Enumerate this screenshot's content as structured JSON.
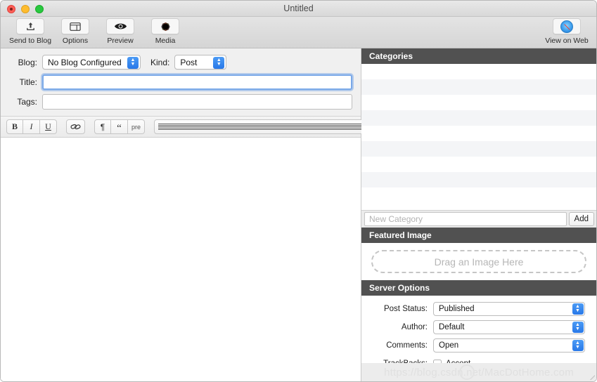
{
  "window": {
    "title": "Untitled",
    "traffic_lights": [
      "close-red",
      "minimize-yellow",
      "zoom-green"
    ]
  },
  "toolbar": {
    "items": [
      {
        "label": "Send to Blog",
        "icon": "upload-arrow-icon"
      },
      {
        "label": "Options",
        "icon": "window-layout-icon"
      },
      {
        "label": "Preview",
        "icon": "eye-icon"
      },
      {
        "label": "Media",
        "icon": "photos-pinwheel-icon"
      }
    ],
    "right_items": [
      {
        "label": "View on Web",
        "icon": "safari-compass-icon"
      }
    ]
  },
  "meta": {
    "blog_label": "Blog:",
    "blog_value": "No Blog Configured",
    "kind_label": "Kind:",
    "kind_value": "Post",
    "title_label": "Title:",
    "title_value": "",
    "title_placeholder": "",
    "tags_label": "Tags:",
    "tags_value": "",
    "tags_placeholder": ""
  },
  "format_bar": {
    "groups": [
      {
        "buttons": [
          {
            "name": "bold-button",
            "glyph": "B"
          },
          {
            "name": "italic-button",
            "glyph": "I"
          },
          {
            "name": "underline-button",
            "glyph": "U"
          }
        ]
      },
      {
        "buttons": [
          {
            "name": "link-button",
            "glyph": "link-icon"
          }
        ]
      },
      {
        "buttons": [
          {
            "name": "paragraph-button",
            "glyph": "¶"
          },
          {
            "name": "blockquote-button",
            "glyph": "“"
          },
          {
            "name": "preformatted-button",
            "glyph": "pre"
          }
        ]
      },
      {
        "buttons": [
          {
            "name": "align-left-button",
            "glyph": "align-left-icon"
          },
          {
            "name": "align-center-button",
            "glyph": "align-center-icon"
          },
          {
            "name": "align-right-button",
            "glyph": "align-right-icon"
          }
        ]
      }
    ]
  },
  "editor": {
    "content": "",
    "placeholder": ""
  },
  "sidebar": {
    "categories": {
      "header": "Categories",
      "rows": 9,
      "items": [],
      "new_category_placeholder": "New Category",
      "new_category_value": "",
      "add_label": "Add"
    },
    "featured_image": {
      "header": "Featured Image",
      "dropzone_text": "Drag an Image Here"
    },
    "server_options": {
      "header": "Server Options",
      "fields": [
        {
          "label": "Post Status:",
          "value": "Published",
          "type": "popup"
        },
        {
          "label": "Author:",
          "value": "Default",
          "type": "popup"
        },
        {
          "label": "Comments:",
          "value": "Open",
          "type": "popup"
        },
        {
          "label": "TrackBacks:",
          "value": "Accept",
          "type": "checkbox",
          "checked": false
        }
      ]
    }
  },
  "watermark": {
    "text": "https://blog.csdn.net/MacDotHome.com"
  },
  "colors": {
    "section_header_bg": "#515151",
    "accent_blue": "#2878e8",
    "focus_ring": "#7aa9e8",
    "toolbar_bg": "#dcdcdc",
    "row_alt_bg": "#f4f5f7"
  }
}
